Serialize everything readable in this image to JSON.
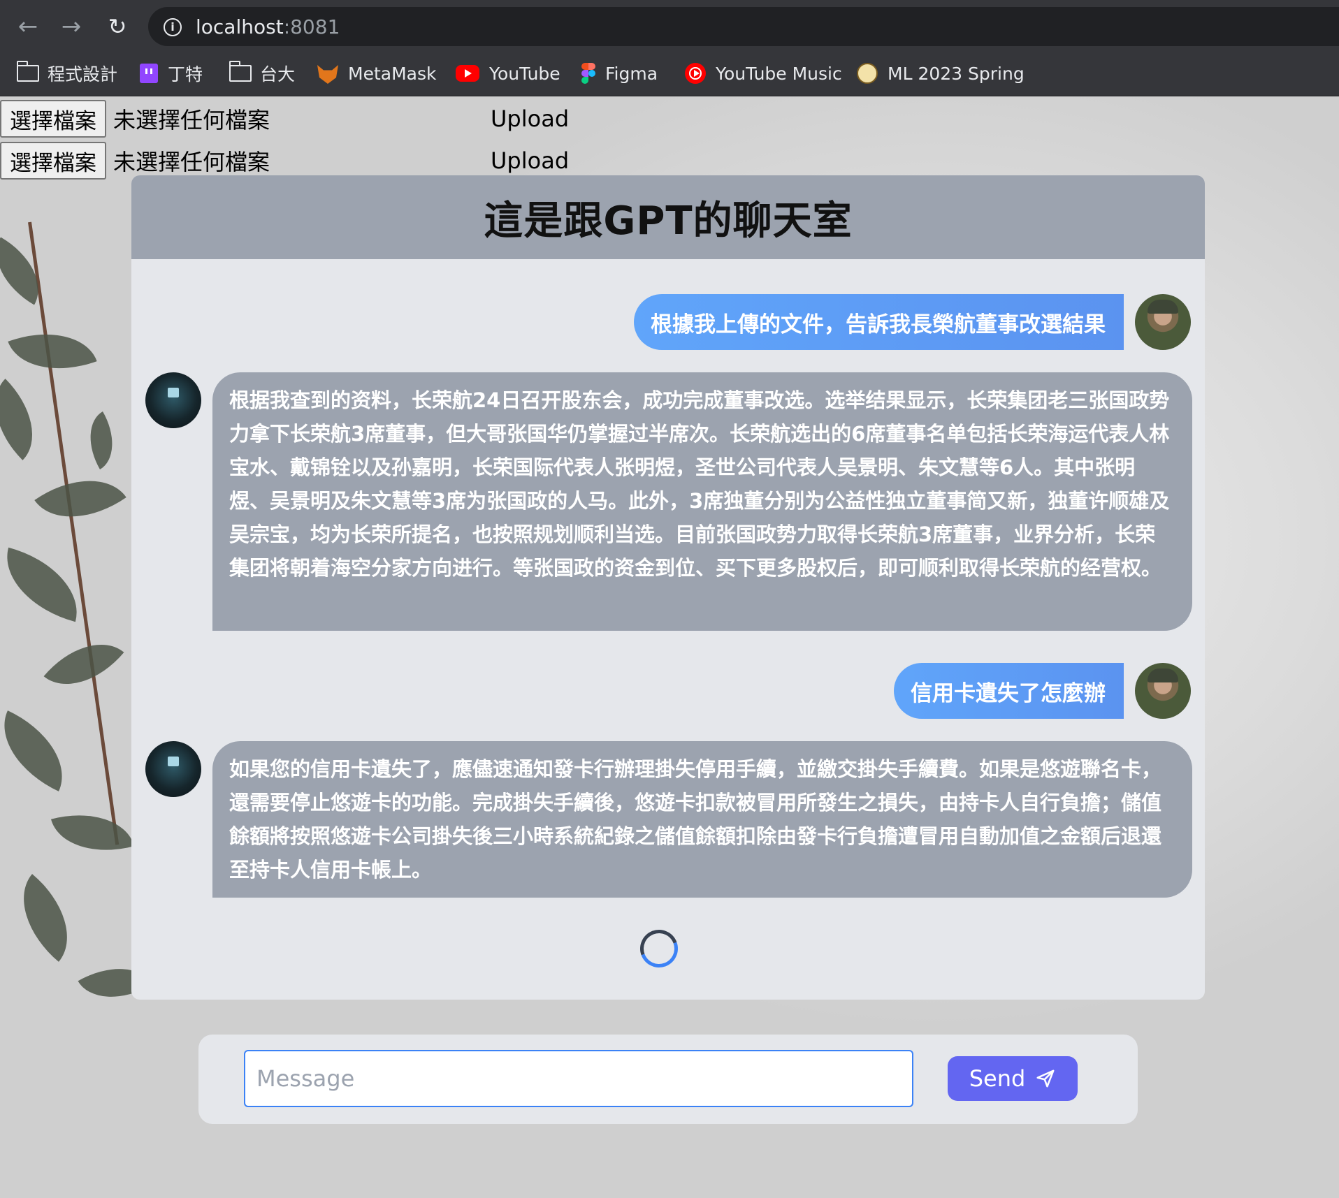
{
  "browser": {
    "url_host": "localhost",
    "url_port": ":8081",
    "bookmarks": [
      {
        "label": "程式設計",
        "icon": "folder-icon"
      },
      {
        "label": "丁特",
        "icon": "twitch-icon"
      },
      {
        "label": "台大",
        "icon": "folder-icon"
      },
      {
        "label": "MetaMask",
        "icon": "metamask-icon"
      },
      {
        "label": "YouTube",
        "icon": "youtube-icon"
      },
      {
        "label": "Figma",
        "icon": "figma-icon"
      },
      {
        "label": "YouTube Music",
        "icon": "youtube-music-icon"
      },
      {
        "label": "ML 2023 Spring",
        "icon": "ml-logo-icon"
      }
    ]
  },
  "uploads": [
    {
      "choose_label": "選擇檔案",
      "status": "未選擇任何檔案",
      "upload_label": "Upload"
    },
    {
      "choose_label": "選擇檔案",
      "status": "未選擇任何檔案",
      "upload_label": "Upload"
    }
  ],
  "chat": {
    "title": "這是跟GPT的聊天室",
    "messages": [
      {
        "role": "user",
        "text": "根據我上傳的文件，告訴我長榮航董事改選結果"
      },
      {
        "role": "bot",
        "text": "根据我查到的资料，长荣航24日召开股东会，成功完成董事改选。选举结果显示，长荣集团老三张国政势力拿下长荣航3席董事，但大哥张国华仍掌握过半席次。长荣航选出的6席董事名单包括长荣海运代表人林宝水、戴锦铨以及孙嘉明，长荣国际代表人张明煜，圣世公司代表人吴景明、朱文慧等6人。其中张明煜、吴景明及朱文慧等3席为张国政的人马。此外，3席独董分别为公益性独立董事简又新，独董许顺雄及吴宗宝，均为长荣所提名，也按照规划顺利当选。目前张国政势力取得长荣航3席董事，业界分析，长荣集团将朝着海空分家方向进行。等张国政的资金到位、买下更多股权后，即可顺利取得长荣航的经营权。"
      },
      {
        "role": "user",
        "text": "信用卡遺失了怎麼辦"
      },
      {
        "role": "bot",
        "text": "如果您的信用卡遺失了，應儘速通知發卡行辦理掛失停用手續，並繳交掛失手續費。如果是悠遊聯名卡，還需要停止悠遊卡的功能。完成掛失手續後，悠遊卡扣款被冒用所發生之損失，由持卡人自行負擔；儲值餘額將按照悠遊卡公司掛失後三小時系統紀錄之儲值餘額扣除由發卡行負擔遭冒用自動加值之金額后退還至持卡人信用卡帳上。"
      }
    ],
    "loading": true
  },
  "composer": {
    "placeholder": "Message",
    "value": "",
    "send_label": "Send"
  },
  "colors": {
    "user_bubble": "#60a5fa",
    "bot_bubble": "#9ca3af",
    "header": "#9ca3af",
    "send_button": "#6366f1"
  }
}
